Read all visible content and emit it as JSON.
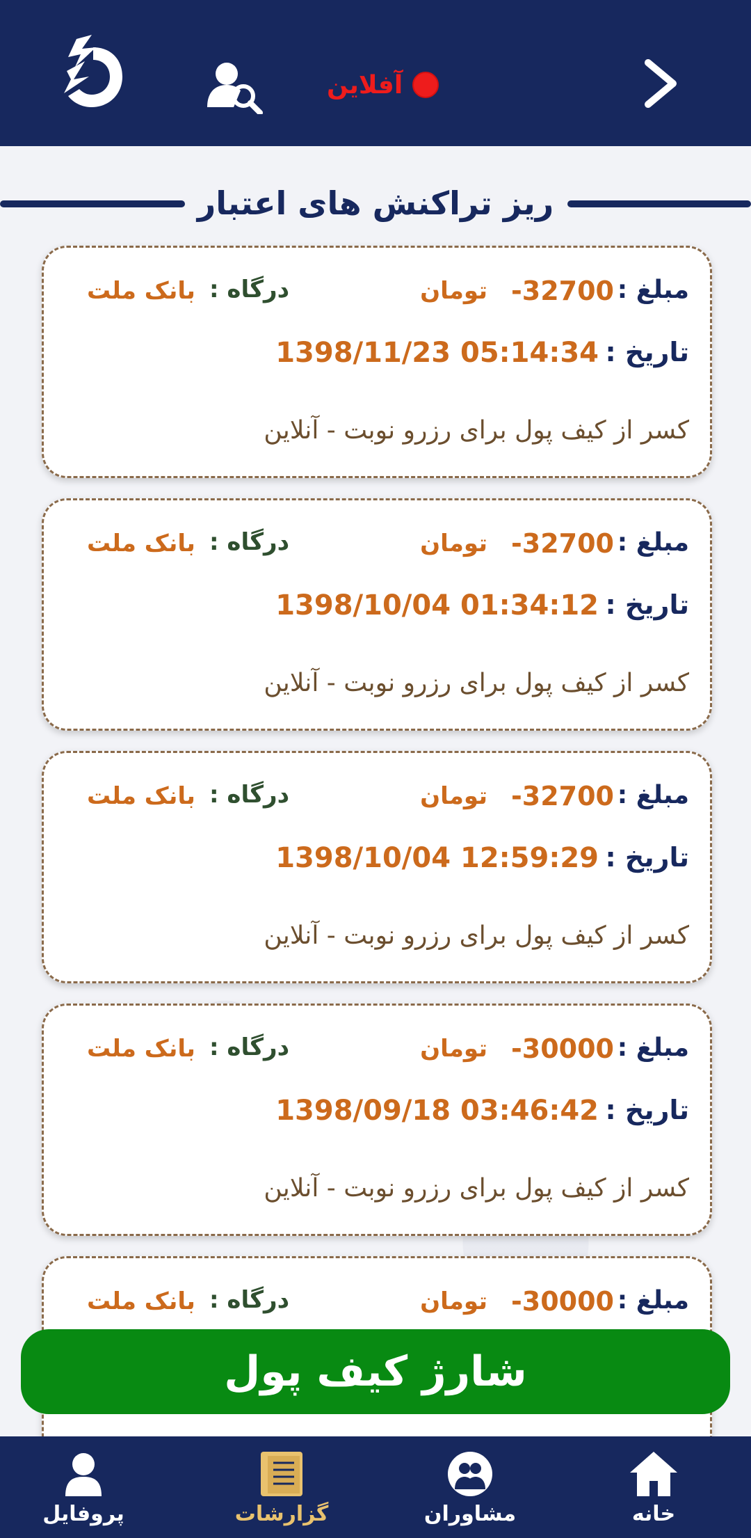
{
  "header": {
    "status_text": "آفلاین",
    "status_color": "#ee1c1c",
    "logo_icon": "app-logo-icon",
    "search_icon": "user-search-icon",
    "back_icon": "chevron-right-icon"
  },
  "section_title": "ریز  تراکنش های اعتبار",
  "labels": {
    "amount": "مبلغ :",
    "date": "تاریخ :",
    "gateway": "درگاه :",
    "currency": "تومان"
  },
  "transactions": [
    {
      "amount": "-32700",
      "date": "1398/11/23 05:14:34",
      "gateway": "بانک ملت",
      "description": "کسر از کیف پول برای رزرو نوبت - آنلاین"
    },
    {
      "amount": "-32700",
      "date": "1398/10/04 01:34:12",
      "gateway": "بانک ملت",
      "description": "کسر از کیف پول برای رزرو نوبت - آنلاین"
    },
    {
      "amount": "-32700",
      "date": "1398/10/04 12:59:29",
      "gateway": "بانک ملت",
      "description": "کسر از کیف پول برای رزرو نوبت - آنلاین"
    },
    {
      "amount": "-30000",
      "date": "1398/09/18 03:46:42",
      "gateway": "بانک ملت",
      "description": "کسر از کیف پول برای رزرو نوبت - آنلاین"
    },
    {
      "amount": "-30000",
      "date": "",
      "gateway": "بانک ملت",
      "description": ""
    }
  ],
  "charge_button": "شارژ کیف پول",
  "bottom_nav": [
    {
      "label": "خانه",
      "icon": "home-icon",
      "active": false
    },
    {
      "label": "مشاوران",
      "icon": "consultants-icon",
      "active": false
    },
    {
      "label": "گزارشات",
      "icon": "reports-icon",
      "active": true
    },
    {
      "label": "پروفایل",
      "icon": "profile-icon",
      "active": false
    }
  ],
  "colors": {
    "primary": "#17285e",
    "accent": "#cc6a1c",
    "charge": "#088a12",
    "active_nav": "#e9c26e"
  }
}
